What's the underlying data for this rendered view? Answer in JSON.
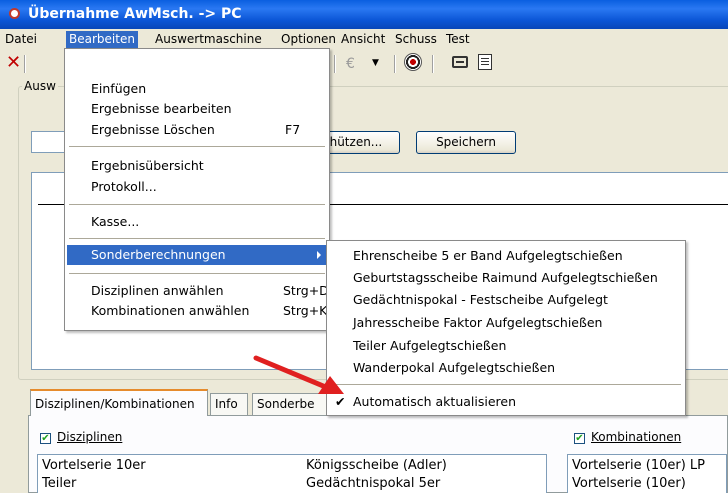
{
  "window": {
    "title": "Übernahme AwMsch. -> PC"
  },
  "menubar": {
    "items": [
      "Datei",
      "Bearbeiten",
      "Auswertmaschine",
      "Optionen",
      "Ansicht",
      "Schuss",
      "Test"
    ]
  },
  "toolbar": {
    "euro_symbol": "€"
  },
  "group": {
    "legend": "Ausw"
  },
  "buttons": {
    "schuetzen": "chützen...",
    "speichern": "Speichern"
  },
  "bearbeiten_menu": {
    "items": [
      {
        "label": "Einfügen",
        "shortcut": ""
      },
      {
        "label": "Ergebnisse bearbeiten",
        "shortcut": ""
      },
      {
        "label": "Ergebnisse Löschen",
        "shortcut": "F7"
      },
      {
        "label": "Ergebnisübersicht",
        "shortcut": ""
      },
      {
        "label": "Protokoll...",
        "shortcut": ""
      },
      {
        "label": "Kasse...",
        "shortcut": ""
      },
      {
        "label": "Sonderberechnungen",
        "shortcut": ""
      },
      {
        "label": "Disziplinen anwählen",
        "shortcut": "Strg+D"
      },
      {
        "label": "Kombinationen anwählen",
        "shortcut": "Strg+K"
      }
    ]
  },
  "sonder_menu": {
    "items": [
      "Ehrenscheibe 5 er Band Aufgelegtschießen",
      "Geburtstagsscheibe Raimund Aufgelegtschießen",
      "Gedächtnispokal - Festscheibe Aufgelegt",
      "Jahresscheibe Faktor Aufgelegtschießen",
      "Teiler Aufgelegtschießen",
      "Wanderpokal Aufgelegtschießen"
    ],
    "auto_update": "Automatisch aktualisieren",
    "check_mark": "✔"
  },
  "tabs": [
    "Disziplinen/Kombinationen",
    "Info",
    "Sonderbe"
  ],
  "disziplinen": {
    "label": "Disziplinen",
    "checked": true,
    "items_col1": [
      "Vortelserie 10er",
      "Teiler"
    ],
    "items_col2": [
      "Königsscheibe (Adler)",
      "Gedächtnispokal 5er"
    ]
  },
  "kombinationen": {
    "label": "Kombinationen",
    "checked": true,
    "items": [
      "Vortelserie (10er) LP",
      "Vortelserie (10er)"
    ]
  },
  "colors": {
    "titlebar": "#0a5fe0",
    "highlight": "#316ac5",
    "annotation_arrow": "#e02020"
  }
}
